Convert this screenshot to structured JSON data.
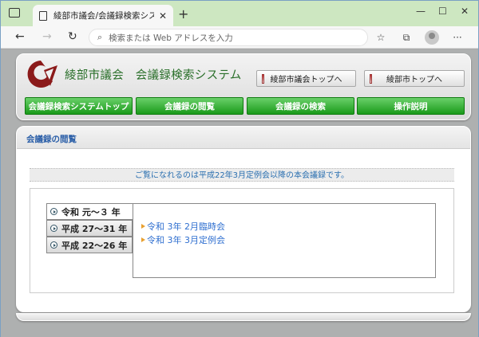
{
  "browser": {
    "tab_title": "綾部市議会/会議録検索システム",
    "tab_close": "✕",
    "new_tab": "+",
    "window_controls": {
      "minimize": "—",
      "maximize": "☐",
      "close": "✕"
    },
    "nav": {
      "back": "←",
      "forward": "→",
      "reload": "↻"
    },
    "address_placeholder": "検索または Web アドレスを入力",
    "toolbar_icons": [
      "favorites-icon",
      "collections-icon",
      "profile-avatar",
      "more-menu-icon"
    ],
    "more": "···"
  },
  "header": {
    "site_name": "綾部市議会　会議録検索システム",
    "top_buttons": [
      "綾部市議会トップへ",
      "綾部市トップへ"
    ],
    "nav": [
      "会議録検索システムトップ",
      "会議録の閲覧",
      "会議録の検索",
      "操作説明"
    ]
  },
  "content": {
    "section_title": "会議録の閲覧",
    "notice": "ご覧になれるのは平成22年3月定例会以降の本会議録です。",
    "year_ranges": [
      "令和 元～３ 年",
      "平成 27～31 年",
      "平成 22～26 年"
    ],
    "meetings": [
      "令和 3年 2月臨時会",
      "令和 3年 3月定例会"
    ]
  },
  "colors": {
    "accent_green": "#1a9a1a",
    "link_blue": "#2f6fd0",
    "title_blue": "#2b5fa8",
    "logo_red": "#8b1a1a"
  }
}
